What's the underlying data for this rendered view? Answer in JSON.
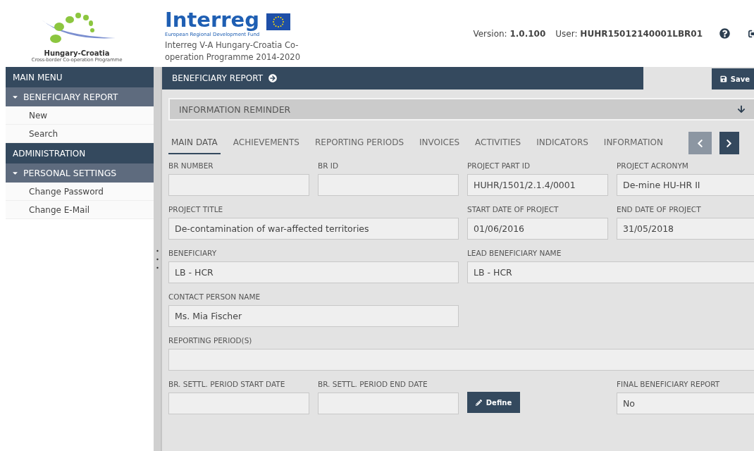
{
  "header": {
    "logo_title": "Hungary-Croatia",
    "logo_subtitle": "Cross-border Co-operation Programme",
    "programme": "Interreg V-A Hungary-Croatia Co-operation Programme 2014-2020",
    "brand": "Interreg",
    "brand_note": "European Regional Development Fund",
    "version_label": "Version:",
    "version": "1.0.100",
    "user_label": "User:",
    "user": "HUHR15012140001LBR01"
  },
  "sidebar": {
    "sections": [
      {
        "title": "MAIN MENU",
        "groups": [
          {
            "title": "BENEFICIARY REPORT",
            "expanded": true,
            "items": [
              {
                "label": "New"
              },
              {
                "label": "Search"
              }
            ]
          }
        ]
      },
      {
        "title": "ADMINISTRATION",
        "groups": [
          {
            "title": "PERSONAL SETTINGS",
            "expanded": true,
            "items": [
              {
                "label": "Change Password"
              },
              {
                "label": "Change E-Mail"
              }
            ]
          }
        ]
      }
    ]
  },
  "page": {
    "title": "BENEFICIARY REPORT",
    "save": "Save",
    "reminder": "INFORMATION REMINDER",
    "tabs": [
      {
        "label": "MAIN DATA",
        "selected": true
      },
      {
        "label": "ACHIEVEMENTS",
        "selected": false
      },
      {
        "label": "REPORTING PERIODS",
        "selected": false
      },
      {
        "label": "INVOICES",
        "selected": false
      },
      {
        "label": "ACTIVITIES",
        "selected": false
      },
      {
        "label": "INDICATORS",
        "selected": false
      },
      {
        "label": "INFORMATION",
        "selected": false
      }
    ],
    "tab_nav": [
      {
        "kind": "prev",
        "disabled": true
      },
      {
        "kind": "next",
        "disabled": false
      }
    ],
    "form": [
      [
        {
          "kind": "field",
          "label": "BR NUMBER"
        },
        {
          "kind": "field",
          "label": "BR ID"
        },
        {
          "kind": "field",
          "label": "PROJECT PART ID",
          "value": "HUHR/1501/2.1.4/0001"
        },
        {
          "kind": "field",
          "label": "PROJECT ACRONYM",
          "value": "De-mine HU-HR II"
        }
      ],
      [
        {
          "kind": "field",
          "label": "PROJECT TITLE",
          "value": "De-contamination of war-affected territories"
        },
        {
          "kind": "field",
          "label": "START DATE OF PROJECT",
          "value": "01/06/2016"
        },
        {
          "kind": "field",
          "label": "END DATE OF PROJECT",
          "value": "31/05/2018"
        }
      ],
      [
        {
          "kind": "field",
          "label": "BENEFICIARY",
          "value": "LB - HCR"
        },
        {
          "kind": "field",
          "label": "LEAD BENEFICIARY NAME",
          "value": "LB - HCR"
        }
      ],
      [
        {
          "kind": "field",
          "label": "CONTACT PERSON NAME",
          "value": "Ms. Mia Fischer"
        }
      ],
      [
        {
          "kind": "field",
          "label": "REPORTING PERIOD(S)"
        }
      ],
      [
        {
          "kind": "field",
          "label": "BR. SETTL. PERIOD START DATE"
        },
        {
          "kind": "field",
          "label": "BR. SETTL. PERIOD END DATE"
        },
        {
          "kind": "button",
          "label": "Define"
        },
        {
          "kind": "field",
          "label": "FINAL BENEFICIARY REPORT",
          "value": "No"
        }
      ]
    ]
  }
}
